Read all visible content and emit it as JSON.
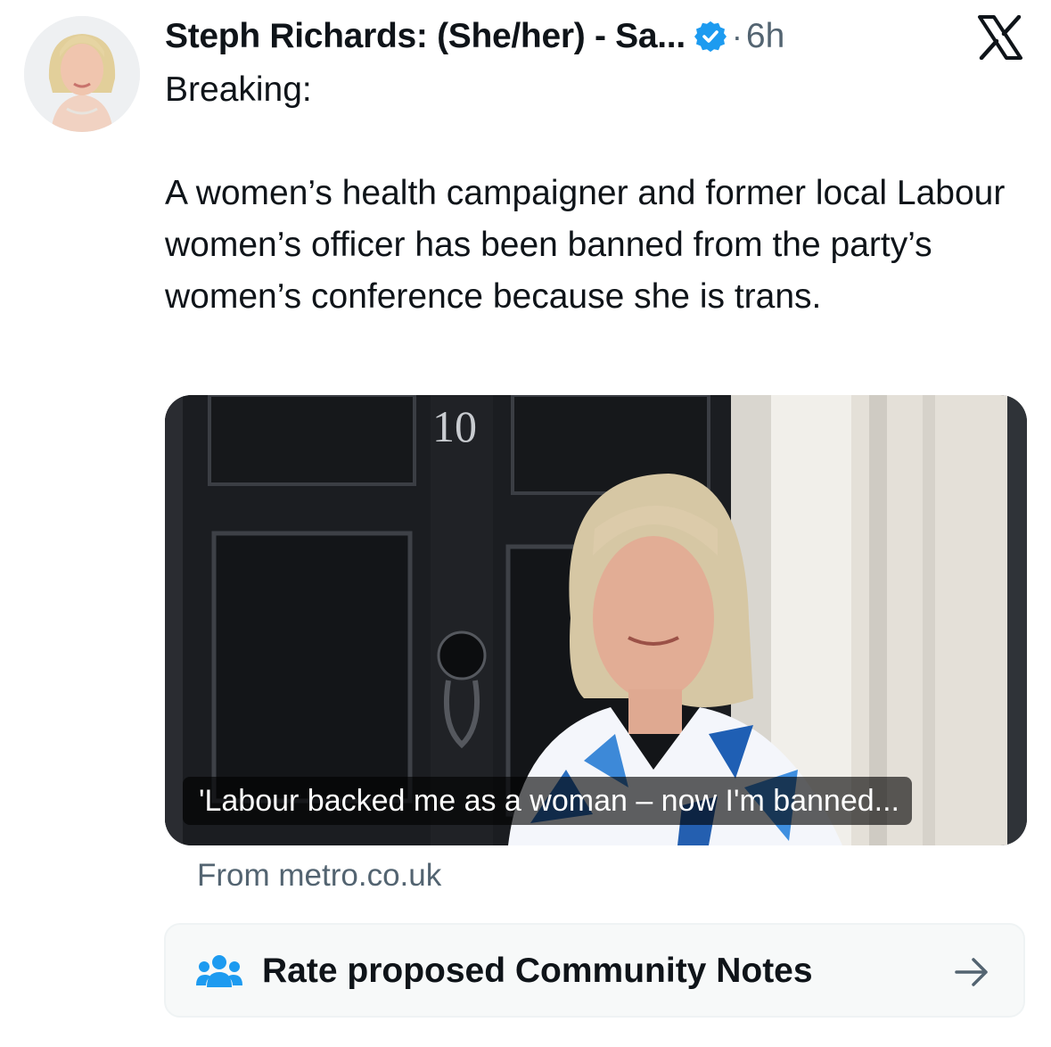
{
  "author": {
    "name": "Steph Richards: (She/her) - Sa...",
    "verified_icon": "verified-badge-icon",
    "separator": "·",
    "time": "6h"
  },
  "platform_logo": "x-logo-icon",
  "tweet": {
    "line1": "Breaking:",
    "body": "A women’s health campaigner and former local Labour women’s officer has been banned from the party’s women’s conference because she is trans."
  },
  "media": {
    "door_number": "10",
    "caption": "'Labour backed me as a woman – now I'm banned..."
  },
  "link_source": "From metro.co.uk",
  "community_notes": {
    "icon": "people-icon",
    "label": "Rate proposed Community Notes",
    "arrow": "arrow-right-icon"
  },
  "colors": {
    "verified_blue": "#1d9bf0",
    "secondary_text": "#536471",
    "primary_text": "#0f1419"
  }
}
